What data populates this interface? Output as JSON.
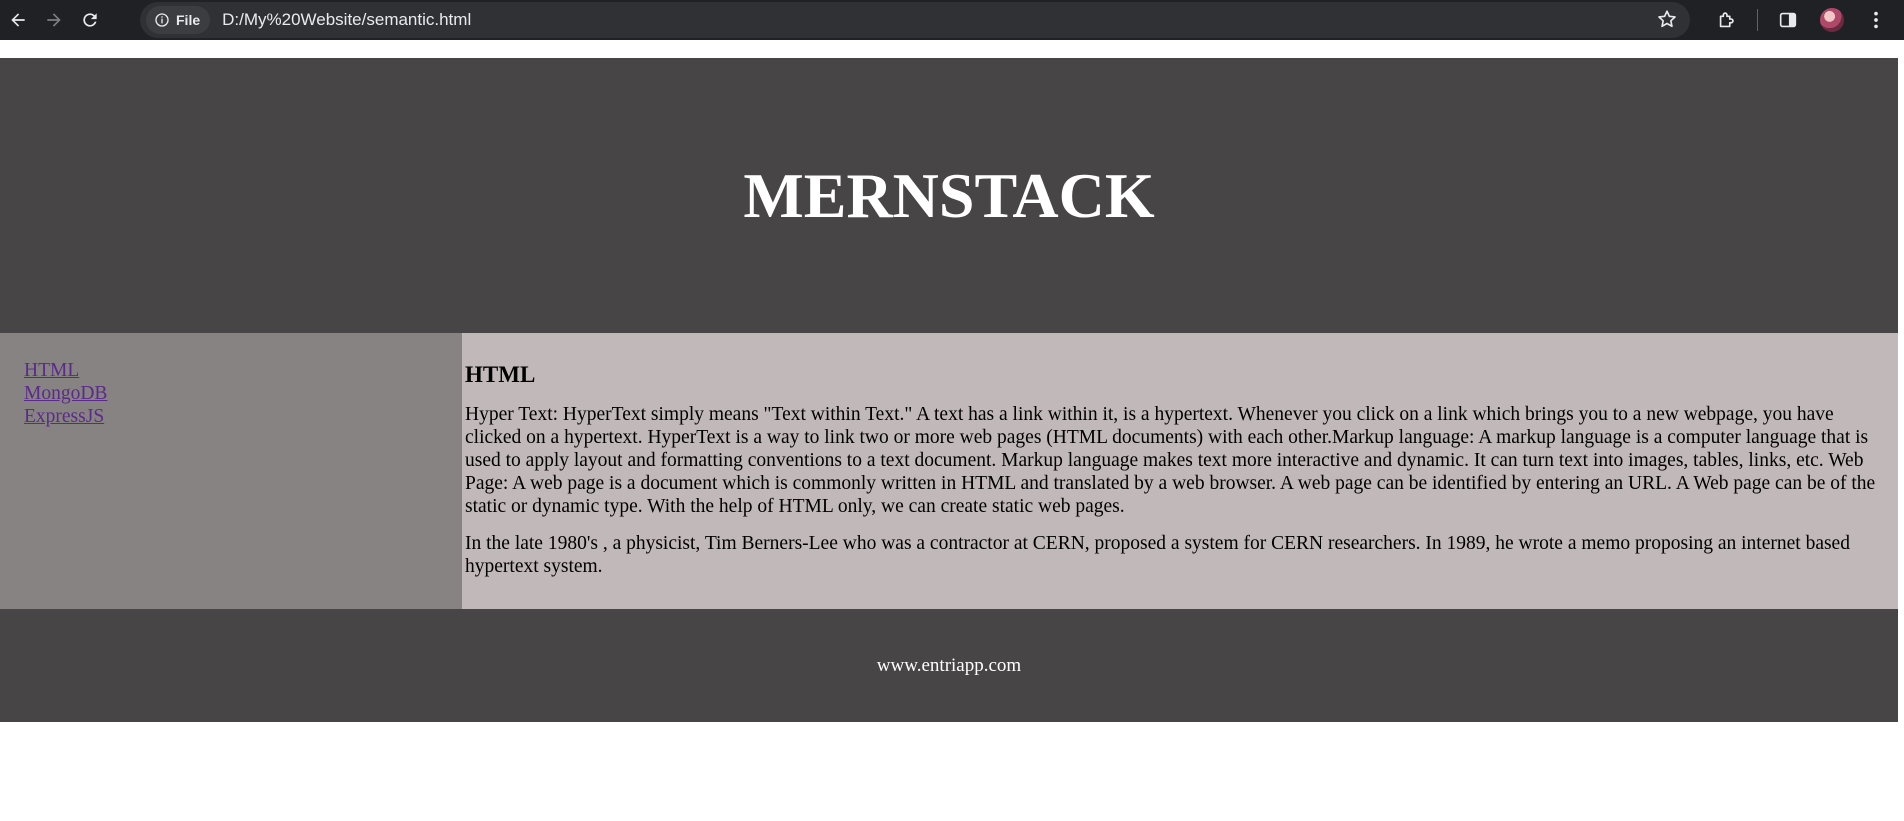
{
  "browser": {
    "site_chip_label": "File",
    "url": "D:/My%20Website/semantic.html"
  },
  "header": {
    "title": "MERNSTACK"
  },
  "sidebar": {
    "links": [
      "HTML",
      "MongoDB",
      "ExpressJS"
    ]
  },
  "main": {
    "heading": "HTML",
    "paragraphs": [
      "Hyper Text: HyperText simply means \"Text within Text.\" A text has a link within it, is a hypertext. Whenever you click on a link which brings you to a new webpage, you have clicked on a hypertext. HyperText is a way to link two or more web pages (HTML documents) with each other.Markup language: A markup language is a computer language that is used to apply layout and formatting conventions to a text document. Markup language makes text more interactive and dynamic. It can turn text into images, tables, links, etc. Web Page: A web page is a document which is commonly written in HTML and translated by a web browser. A web page can be identified by entering an URL. A Web page can be of the static or dynamic type. With the help of HTML only, we can create static web pages.",
      "In the late 1980's , a physicist, Tim Berners-Lee who was a contractor at CERN, proposed a system for CERN researchers. In 1989, he wrote a memo proposing an internet based hypertext system."
    ]
  },
  "footer": {
    "text": "www.entriapp.com"
  }
}
